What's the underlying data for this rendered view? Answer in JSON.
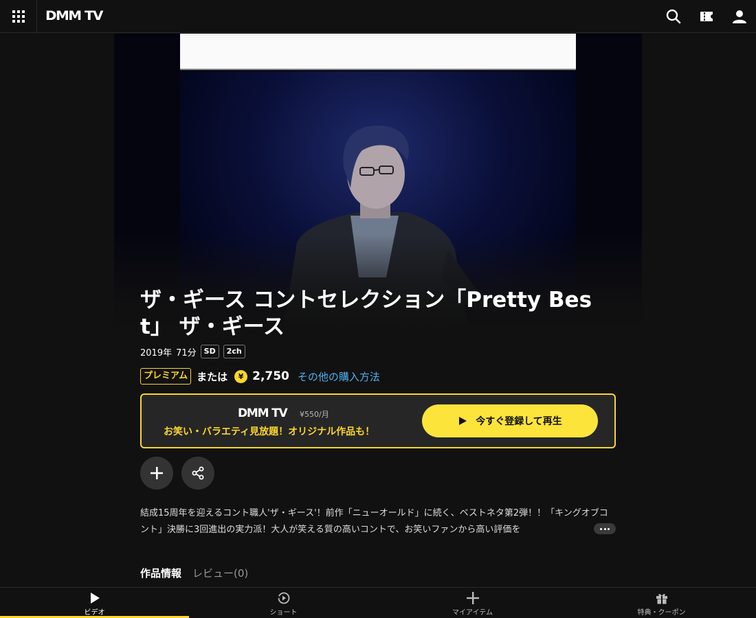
{
  "header": {
    "logo": "DMM TV",
    "icons": [
      "grid-menu-icon",
      "search-icon",
      "ticket-icon",
      "user-icon"
    ]
  },
  "content": {
    "title": "ザ・ギース コントセレクション「Pretty Best」 ザ・ギース",
    "year": "2019年",
    "duration": "71分",
    "badges": [
      "SD",
      "2ch"
    ],
    "premium_label": "プレミアム",
    "or_label": "または",
    "yen_symbol": "¥",
    "price": "2,750",
    "other_purchase": "その他の購入方法"
  },
  "promo": {
    "logo": "DMM TV",
    "price": "¥550/月",
    "copy": "お笑い・バラエティ見放題！オリジナル作品も！",
    "cta_label": "今すぐ登録して再生"
  },
  "description": "結成15周年を迎えるコント職人'ザ・ギース'！前作「ニューオールド」に続く、ベストネタ第2弾！！「キングオブコント」決勝に3回進出の実力派！大人が笑える質の高いコントで、お笑いファンから高い評価を",
  "tabs": {
    "info": "作品情報",
    "review": "レビュー(0)"
  },
  "bottom_nav": [
    {
      "label": "ビデオ",
      "icon": "play-icon",
      "active": true
    },
    {
      "label": "ショート",
      "icon": "short-video-icon",
      "active": false
    },
    {
      "label": "マイアイテム",
      "icon": "plus-icon",
      "active": false
    },
    {
      "label": "特典・クーポン",
      "icon": "gift-icon",
      "active": false
    }
  ],
  "colors": {
    "accent": "#fcd62b",
    "cta": "#fce43b",
    "link": "#4fb0f0",
    "background": "#111111"
  }
}
